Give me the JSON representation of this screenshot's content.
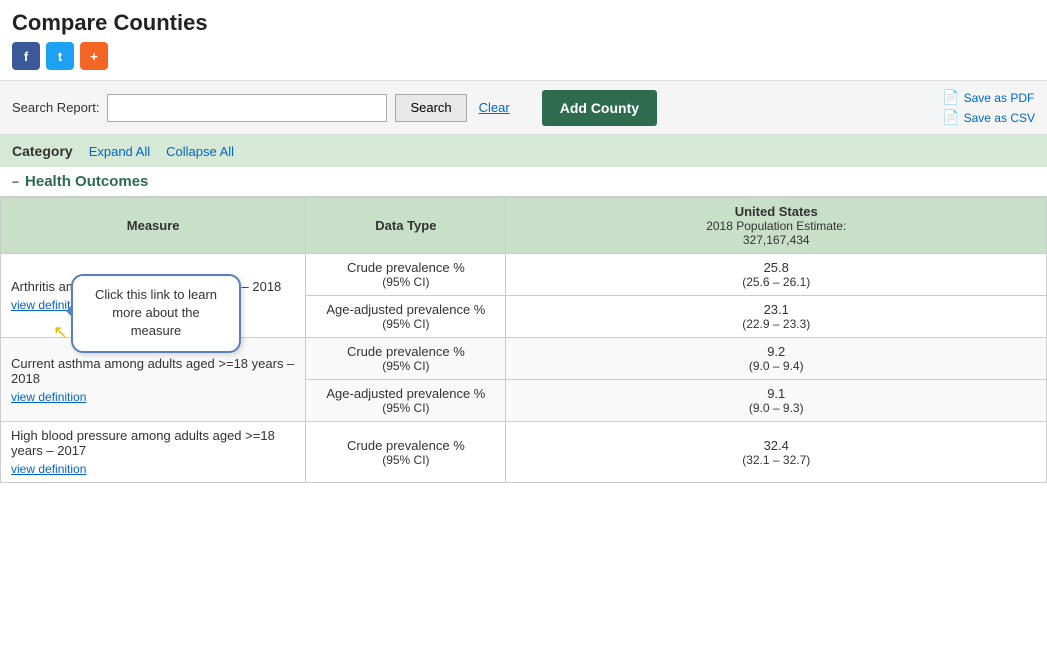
{
  "page": {
    "title": "Compare Counties"
  },
  "social": {
    "fb_label": "f",
    "tw_label": "t",
    "share_label": "+"
  },
  "toolbar": {
    "search_report_label": "Search Report:",
    "search_input_placeholder": "",
    "search_button": "Search",
    "clear_button": "Clear",
    "add_county_button": "Add County",
    "save_pdf_label": "Save as PDF",
    "save_csv_label": "Save as CSV"
  },
  "category_bar": {
    "label": "Category",
    "expand_all": "Expand All",
    "collapse_all": "Collapse All"
  },
  "section": {
    "title": "Health Outcomes",
    "collapse_icon": "−"
  },
  "table_header": {
    "measure": "Measure",
    "data_type": "Data Type",
    "us_title": "United States",
    "us_pop_label": "2018 Population Estimate:",
    "us_pop_value": "327,167,434"
  },
  "tooltip": {
    "text": "Click this link to learn more about the measure"
  },
  "rows": [
    {
      "measure": "Arthritis among adults aged >=18 years – 2018",
      "view_def": "view definition",
      "data_type_1": "Crude prevalence %",
      "ci_1": "(95% CI)",
      "value_1": "25.8",
      "range_1": "(25.6 – 26.1)",
      "data_type_2": "Age-adjusted prevalence %",
      "ci_2": "(95% CI)",
      "value_2": "23.1",
      "range_2": "(22.9 – 23.3)"
    },
    {
      "measure": "Current asthma among adults aged >=18 years – 2018",
      "view_def": "view definition",
      "data_type_1": "Crude prevalence %",
      "ci_1": "(95% CI)",
      "value_1": "9.2",
      "range_1": "(9.0 – 9.4)",
      "data_type_2": "Age-adjusted prevalence %",
      "ci_2": "(95% CI)",
      "value_2": "9.1",
      "range_2": "(9.0 – 9.3)"
    },
    {
      "measure": "High blood pressure among adults aged >=18 years – 2017",
      "view_def": "view definition",
      "data_type_1": "Crude prevalence %",
      "ci_1": "(95% CI)",
      "value_1": "32.4",
      "range_1": "(32.1 – 32.7)",
      "data_type_2": null
    }
  ]
}
